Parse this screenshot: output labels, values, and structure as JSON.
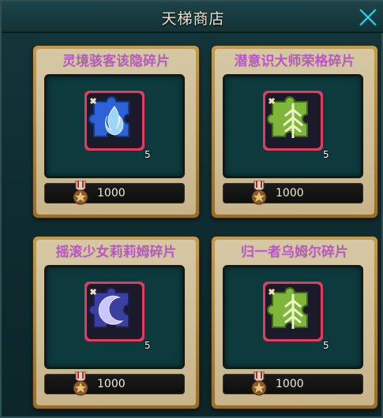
{
  "header": {
    "title": "天梯商店"
  },
  "items": [
    {
      "name": "灵境骇客该隐碎片",
      "count": "5",
      "price": "1000",
      "icon": "blue-flame-puzzle-icon",
      "color": "#2d63d6"
    },
    {
      "name": "潜意识大师荣格碎片",
      "count": "5",
      "price": "1000",
      "icon": "green-tree-puzzle-icon",
      "color": "#7fb53a"
    },
    {
      "name": "摇滚少女莉莉姆碎片",
      "count": "5",
      "price": "1000",
      "icon": "purple-moon-puzzle-icon",
      "color": "#3b3f9e"
    },
    {
      "name": "归一者乌姆尔碎片",
      "count": "5",
      "price": "1000",
      "icon": "green-tree-puzzle-icon",
      "color": "#7fb53a"
    }
  ],
  "colors": {
    "name_text": "#c94fe0",
    "slot_bg": "#0d3b3d",
    "frame_gold": "#c49a4e"
  }
}
